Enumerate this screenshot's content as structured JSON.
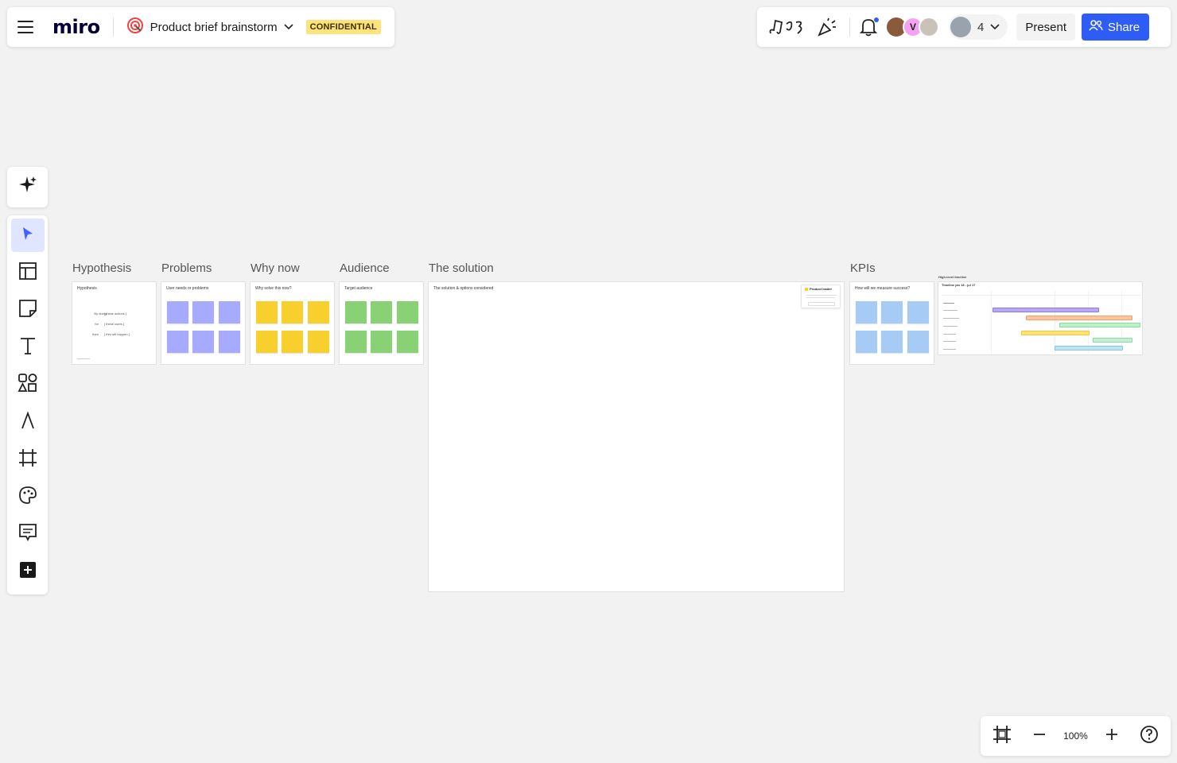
{
  "header": {
    "logo": "miro",
    "board_title": "Product brief brainstorm",
    "badge": "CONFIDENTIAL"
  },
  "topbar": {
    "avatar_initial": "V",
    "collaborator_count": "4",
    "present_label": "Present",
    "share_label": "Share"
  },
  "frames": {
    "hypothesis": {
      "label": "Hypothesis",
      "title": "Hypothesis",
      "rows": [
        {
          "key": "By doing",
          "val": "[ these actions ]"
        },
        {
          "key": "for",
          "val": "[ these users ]"
        },
        {
          "key": "then",
          "val": "[ this will happen ]"
        }
      ]
    },
    "problems": {
      "label": "Problems",
      "title": "User needs or problems"
    },
    "why_now": {
      "label": "Why now",
      "title": "Why solve this now?"
    },
    "audience": {
      "label": "Audience",
      "title": "Target audience"
    },
    "solution": {
      "label": "The solution",
      "title": "The solution & options considered",
      "card_title": "Product leader"
    },
    "kpis": {
      "label": "KPIs",
      "title": "How will we measure success?"
    },
    "timeline": {
      "title": "High-level timeline",
      "subtitle": "Timeline jan 18 - jul 17"
    }
  },
  "zoom": {
    "level": "100%"
  },
  "colors": {
    "accent": "#2e5cf6",
    "sticky_purple": "#a6abff",
    "sticky_yellow": "#f7d02e",
    "sticky_green": "#88d175",
    "sticky_blue": "#a6ccf5",
    "badge": "#fde37a"
  }
}
